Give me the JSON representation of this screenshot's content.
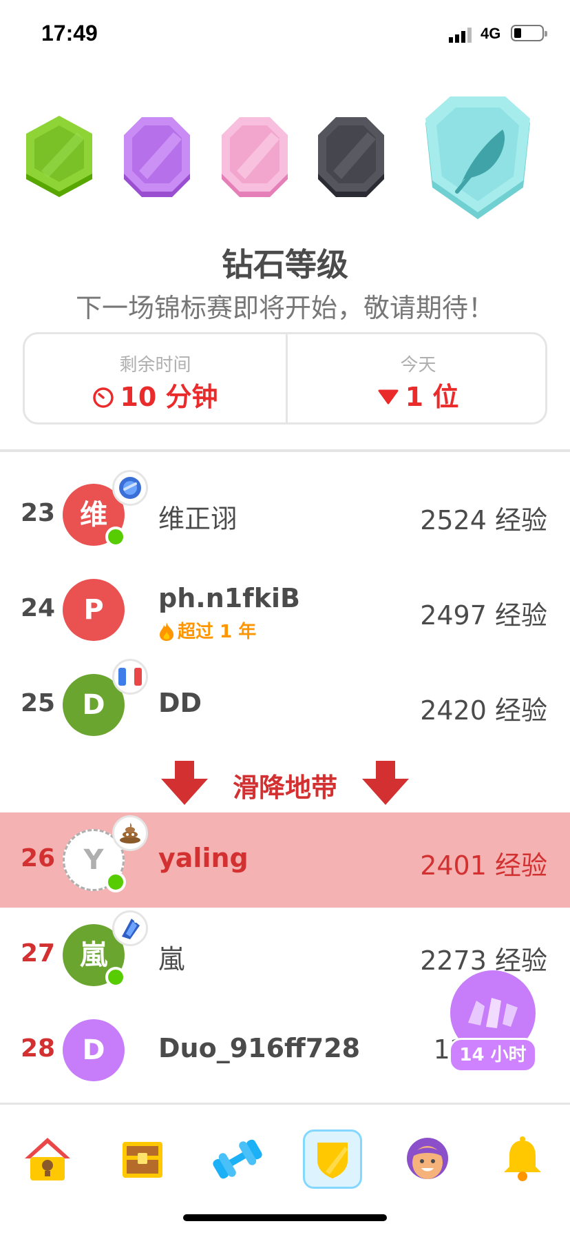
{
  "status_bar": {
    "time": "17:49",
    "network": "4G"
  },
  "league": {
    "title": "钻石等级",
    "subtitle": "下一场锦标赛即将开始，敬请期待！",
    "badges": [
      "bronze-league-icon",
      "amethyst-league-icon",
      "pearl-league-icon",
      "obsidian-league-icon",
      "diamond-league-icon"
    ]
  },
  "stats": {
    "time_left_label": "剩余时间",
    "time_left_value": "10 分钟",
    "today_label": "今天",
    "today_value": "1 位"
  },
  "leaderboard": [
    {
      "rank": "23",
      "initial": "维",
      "name": "维正诩",
      "xp": "2524 经验",
      "avatar_color": "#ea5252",
      "online": true,
      "badge": "sapphire-gem-icon"
    },
    {
      "rank": "24",
      "initial": "P",
      "name": "ph.n1fkiB",
      "streak": "超过 1 年",
      "xp": "2497 经验",
      "avatar_color": "#ea5252",
      "online": false
    },
    {
      "rank": "25",
      "initial": "D",
      "name": "DD",
      "xp": "2420 经验",
      "avatar_color": "#6aa62f",
      "online": false,
      "badge": "french-flag-icon"
    },
    {
      "rank": "26",
      "initial": "Y",
      "name": "yaling",
      "xp": "2401 经验",
      "avatar_color": "#ffffff",
      "online": true,
      "badge": "poop-icon"
    },
    {
      "rank": "27",
      "initial": "嵐",
      "name": "嵐",
      "xp": "2273 经验",
      "avatar_color": "#6aa62f",
      "online": true,
      "badge": "sapphire-crystal-icon"
    },
    {
      "rank": "28",
      "initial": "D",
      "name": "Duo_916ff728",
      "xp": "12",
      "avatar_color": "#c77dfa",
      "online": false
    }
  ],
  "demotion_zone_label": "滑降地带",
  "floating_chest": {
    "label": "14 小时"
  },
  "nav": [
    "home-icon",
    "treasure-chest-icon",
    "dumbbell-icon",
    "shield-icon",
    "profile-avatar-icon",
    "bell-icon"
  ],
  "colors": {
    "accent_red": "#ea2b2b",
    "demotion_red": "#d33131",
    "highlight_row": "#f4b2b2",
    "active_nav": "#84d8ff"
  }
}
